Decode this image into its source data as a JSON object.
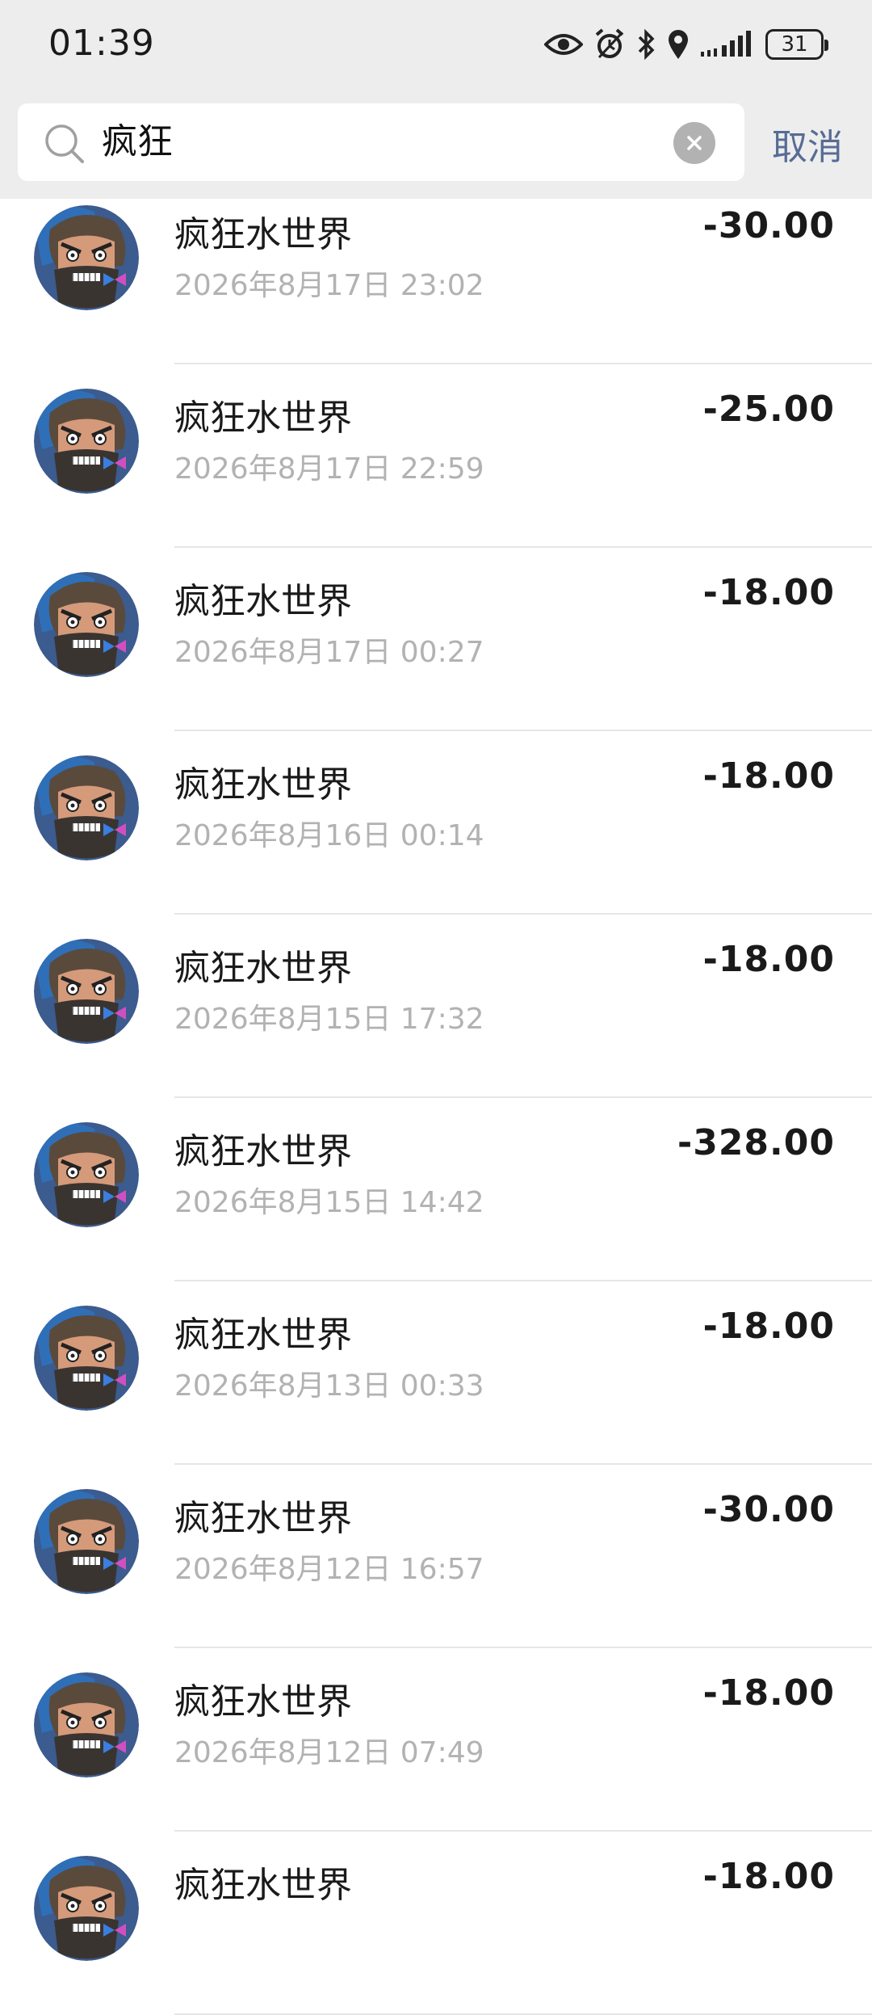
{
  "status_bar": {
    "time": "01:39",
    "battery": "31",
    "icons": [
      "eye-icon",
      "alarm-icon",
      "bluetooth-icon",
      "location-icon",
      "signal-icon",
      "battery-icon"
    ]
  },
  "search": {
    "query": "疯狂",
    "cancel_label": "取消"
  },
  "transactions": [
    {
      "title": "疯狂水世界",
      "time": "2026年8月17日 23:02",
      "amount": "-30.00"
    },
    {
      "title": "疯狂水世界",
      "time": "2026年8月17日 22:59",
      "amount": "-25.00"
    },
    {
      "title": "疯狂水世界",
      "time": "2026年8月17日 00:27",
      "amount": "-18.00"
    },
    {
      "title": "疯狂水世界",
      "time": "2026年8月16日 00:14",
      "amount": "-18.00"
    },
    {
      "title": "疯狂水世界",
      "time": "2026年8月15日 17:32",
      "amount": "-18.00"
    },
    {
      "title": "疯狂水世界",
      "time": "2026年8月15日 14:42",
      "amount": "-328.00"
    },
    {
      "title": "疯狂水世界",
      "time": "2026年8月13日 00:33",
      "amount": "-18.00"
    },
    {
      "title": "疯狂水世界",
      "time": "2026年8月12日 16:57",
      "amount": "-30.00"
    },
    {
      "title": "疯狂水世界",
      "time": "2026年8月12日 07:49",
      "amount": "-18.00"
    },
    {
      "title": "疯狂水世界",
      "time": "",
      "amount": "-18.00"
    }
  ],
  "colors": {
    "header_bg": "#ededed",
    "link": "#576b95",
    "muted_text": "#b2b2b2",
    "divider": "#e6e6e6"
  }
}
